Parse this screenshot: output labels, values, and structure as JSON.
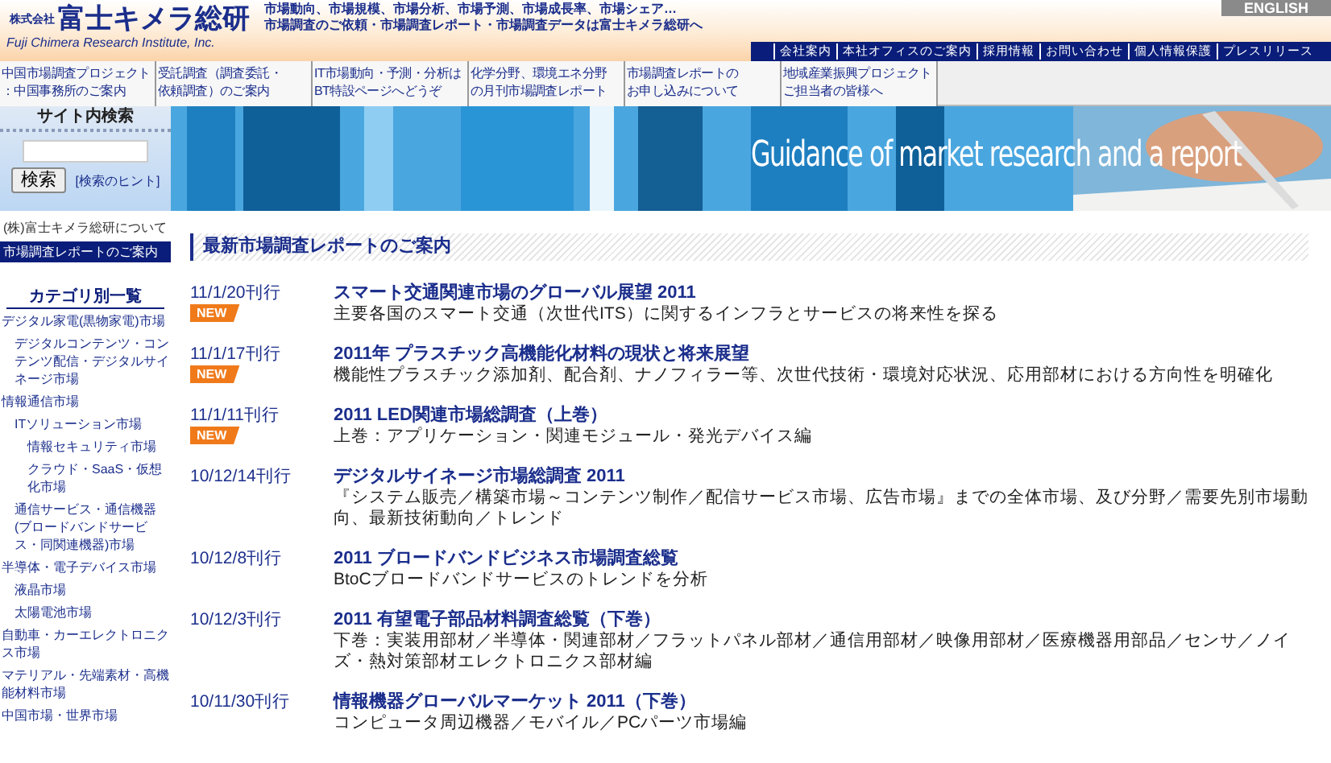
{
  "header": {
    "logo_small": "株式会社",
    "logo_name": "富士キメラ総研",
    "logo_english": "Fuji Chimera Research Institute, Inc.",
    "tagline_lines": [
      "市場動向、市場規模、市場分析、市場予測、市場成長率、市場シェア…",
      "市場調査のご依頼・市場調査レポート・市場調査データは富士キメラ総研へ"
    ],
    "language_link": "ENGLISH",
    "utility_links": [
      "会社案内",
      "本社オフィスのご案内",
      "採用情報",
      "お問い合わせ",
      "個人情報保護",
      "プレスリリース"
    ]
  },
  "nav": [
    {
      "lines": [
        "中国市場調査プロジェクト",
        "：中国事務所のご案内"
      ]
    },
    {
      "lines": [
        "受託調査（調査委託・",
        "依頼調査）のご案内"
      ]
    },
    {
      "lines": [
        "IT市場動向・予測・分析は",
        "BT特設ページへどうぞ"
      ]
    },
    {
      "lines": [
        "化学分野、環境エネ分野",
        "の月刊市場調査レポート"
      ]
    },
    {
      "lines": [
        "市場調査レポートの",
        "お申し込みについて"
      ]
    },
    {
      "lines": [
        "地域産業振興プロジェクト",
        "ご担当者の皆様へ"
      ]
    }
  ],
  "sidebar": {
    "search_title": "サイト内検索",
    "search_button": "検索",
    "search_hint": "[検索のヒント]",
    "links": [
      {
        "label": "(株)富士キメラ総研について",
        "selected": false
      },
      {
        "label": "市場調査レポートのご案内",
        "selected": true
      }
    ],
    "category_title": "カテゴリ別一覧",
    "categories": [
      {
        "label": "デジタル家電(黒物家電)市場",
        "children": [
          {
            "label": "デジタルコンテンツ・コンテンツ配信・デジタルサイネージ市場"
          }
        ]
      },
      {
        "label": "情報通信市場",
        "children": [
          {
            "label": "ITソリューション市場",
            "children": [
              {
                "label": "情報セキュリティ市場"
              },
              {
                "label": "クラウド・SaaS・仮想化市場"
              }
            ]
          },
          {
            "label": "通信サービス・通信機器(ブロードバンドサービス・同関連機器)市場"
          }
        ]
      },
      {
        "label": "半導体・電子デバイス市場",
        "children": [
          {
            "label": "液晶市場"
          },
          {
            "label": "太陽電池市場"
          }
        ]
      },
      {
        "label": "自動車・カーエレクトロニクス市場"
      },
      {
        "label": "マテリアル・先端素材・高機能材料市場"
      },
      {
        "label": "中国市場・世界市場"
      }
    ]
  },
  "banner": {
    "kind": "picture",
    "caption": "Guidance of market research and a report"
  },
  "section_title": "最新市場調査レポートのご案内",
  "reports": [
    {
      "date": "11/1/20刊行",
      "badge": "NEW",
      "title": "スマート交通関連市場のグローバル展望 2011",
      "description": "主要各国のスマート交通（次世代ITS）に関するインフラとサービスの将来性を探る"
    },
    {
      "date": "11/1/17刊行",
      "badge": "NEW",
      "title": "2011年 プラスチック高機能化材料の現状と将来展望",
      "description": "機能性プラスチック添加剤、配合剤、ナノフィラー等、次世代技術・環境対応状況、応用部材における方向性を明確化"
    },
    {
      "date": "11/1/11刊行",
      "badge": "NEW",
      "title": "2011 LED関連市場総調査（上巻）",
      "description": "上巻：アプリケーション・関連モジュール・発光デバイス編"
    },
    {
      "date": "10/12/14刊行",
      "title": "デジタルサイネージ市場総調査 2011",
      "description": "『システム販売／構築市場～コンテンツ制作／配信サービス市場、広告市場』までの全体市場、及び分野／需要先別市場動向、最新技術動向／トレンド"
    },
    {
      "date": "10/12/8刊行",
      "title": "2011 ブロードバンドビジネス市場調査総覧",
      "description": "BtoCブロードバンドサービスのトレンドを分析"
    },
    {
      "date": "10/12/3刊行",
      "title": "2011 有望電子部品材料調査総覧（下巻）",
      "description": "下巻：実装用部材／半導体・関連部材／フラットパネル部材／通信用部材／映像用部材／医療機器用部品／センサ／ノイズ・熱対策部材エレクトロニクス部材編"
    },
    {
      "date": "10/11/30刊行",
      "title": "情報機器グローバルマーケット 2011（下巻）",
      "description": "コンピュータ周辺機器／モバイル／PCパーツ市場編"
    }
  ]
}
